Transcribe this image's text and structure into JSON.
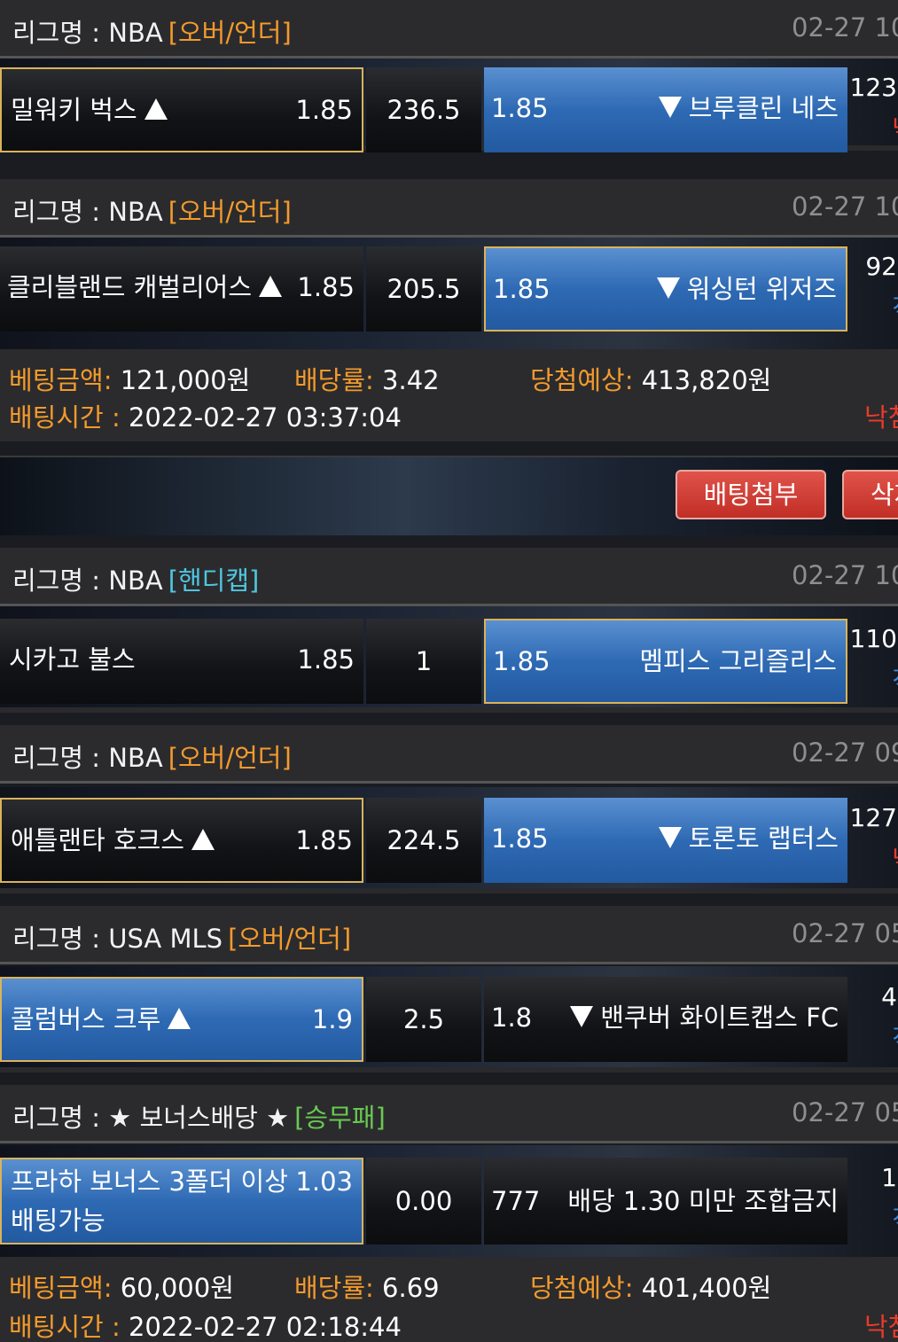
{
  "colors": {
    "type_overunder": "#f39a2c",
    "type_handicap": "#4fc6e0",
    "type_1x2": "#6ac952",
    "result_fail": "#e83a2c",
    "result_hit": "#3a8ae0",
    "selected_border": "#d9b35a",
    "selected_fill": "#2e6ab4"
  },
  "bets": [
    {
      "matches": [
        {
          "league_label": "리그명 : NBA",
          "bet_type": "[오버/언더]",
          "date": "02-27 10",
          "home": "밀워키 벅스",
          "home_odds": "1.85",
          "line": "236.5",
          "away_odds": "1.85",
          "away": "브루클린 네츠",
          "score": "123",
          "result": "낙"
        },
        {
          "league_label": "리그명 : NBA",
          "bet_type": "[오버/언더]",
          "date": "02-27 10",
          "home": "클리블랜드 캐벌리어스",
          "home_odds": "1.85",
          "line": "205.5",
          "away_odds": "1.85",
          "away": "워싱턴 위저즈",
          "score": "92",
          "result": "적"
        }
      ],
      "summary": {
        "amount_label": "베팅금액:",
        "amount": "121,000원",
        "rate_label": "배당률:",
        "rate": "3.42",
        "expected_label": "당첨예상:",
        "expected": "413,820원",
        "time_label": "배팅시간 :",
        "time": "2022-02-27 03:37:04",
        "result": "낙첨"
      }
    },
    {
      "matches": [
        {
          "league_label": "리그명 : NBA",
          "bet_type": "[핸디캡]",
          "date": "02-27 10",
          "home": "시카고 불스",
          "home_odds": "1.85",
          "line": "1",
          "away_odds": "1.85",
          "away": "멤피스 그리즐리스",
          "score": "110",
          "result": "적"
        },
        {
          "league_label": "리그명 : NBA",
          "bet_type": "[오버/언더]",
          "date": "02-27 09",
          "home": "애틀랜타 호크스",
          "home_odds": "1.85",
          "line": "224.5",
          "away_odds": "1.85",
          "away": "토론토 랩터스",
          "score": "127",
          "result": "낙"
        },
        {
          "league_label": "리그명 : USA MLS",
          "bet_type": "[오버/언더]",
          "date": "02-27 05",
          "home": "콜럼버스 크루",
          "home_odds": "1.9",
          "line": "2.5",
          "away_odds": "1.8",
          "away": "밴쿠버 화이트캡스 FC",
          "score": "4",
          "result": "적"
        },
        {
          "league_label": "리그명 : ★ 보너스배당 ★",
          "bet_type": "[승무패]",
          "date": "02-27 05",
          "home_line1": "프라하 보너스 3폴더 이상",
          "home_odds": "1.03",
          "home_line2": "배팅가능",
          "line": "0.00",
          "away_odds": "777",
          "away": "배당 1.30 미만 조합금지",
          "score": "1",
          "result": "적"
        }
      ],
      "summary": {
        "amount_label": "베팅금액:",
        "amount": "60,000원",
        "rate_label": "배당률:",
        "rate": "6.69",
        "expected_label": "당첨예상:",
        "expected": "401,400원",
        "time_label": "배팅시간 :",
        "time": "2022-02-27 02:18:44",
        "result": "낙첨"
      }
    }
  ],
  "actions": {
    "attach_label": "배팅첨부",
    "delete_label": "삭제"
  }
}
